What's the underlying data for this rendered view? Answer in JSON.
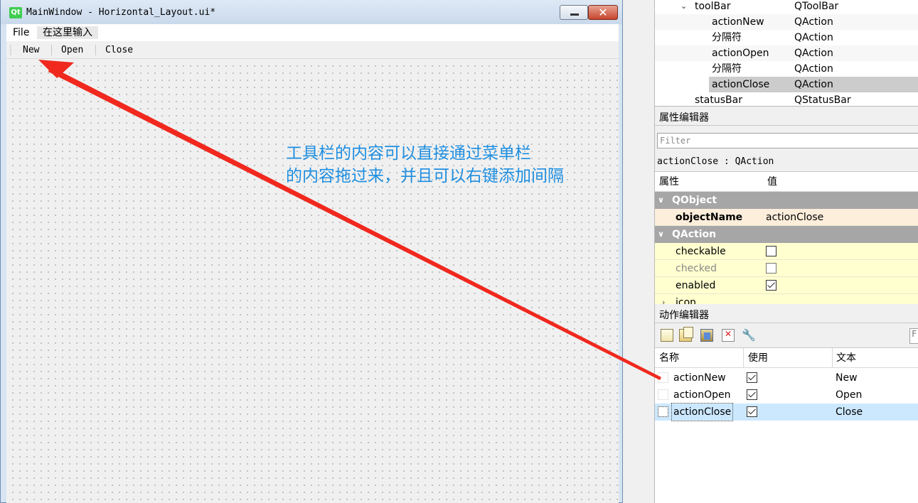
{
  "form_window": {
    "title": "MainWindow - Horizontal_Layout.ui*",
    "icon_label": "Qt",
    "menu": [
      "File",
      "在这里输入"
    ],
    "toolbar": [
      "New",
      "Open",
      "Close"
    ]
  },
  "annotation": {
    "line1": "工具栏的内容可以直接通过菜单栏",
    "line2": "的内容拖过来，并且可以右键添加间隔"
  },
  "object_inspector": {
    "rows": [
      {
        "name": "toolBar",
        "class": "QToolBar"
      },
      {
        "name": "actionNew",
        "class": "QAction"
      },
      {
        "name": "分隔符",
        "class": "QAction"
      },
      {
        "name": "actionOpen",
        "class": "QAction"
      },
      {
        "name": "分隔符",
        "class": "QAction"
      },
      {
        "name": "actionClose",
        "class": "QAction"
      },
      {
        "name": "statusBar",
        "class": "QStatusBar"
      }
    ]
  },
  "property_editor": {
    "title": "属性编辑器",
    "filter_placeholder": "Filter",
    "current_object": "actionClose : QAction",
    "header_property": "属性",
    "header_value": "值",
    "groups": [
      "QObject",
      "QAction"
    ],
    "object_name_label": "objectName",
    "object_name_value": "actionClose",
    "props": [
      {
        "name": "checkable",
        "checked": false
      },
      {
        "name": "checked",
        "checked": false
      },
      {
        "name": "enabled",
        "checked": true
      },
      {
        "name": "icon"
      }
    ]
  },
  "action_editor": {
    "title": "动作编辑器",
    "filter_stub": "F",
    "headers": [
      "名称",
      "使用",
      "文本"
    ],
    "rows": [
      {
        "name": "actionNew",
        "used": true,
        "text": "New"
      },
      {
        "name": "actionOpen",
        "used": true,
        "text": "Open"
      },
      {
        "name": "actionClose",
        "used": true,
        "text": "Close"
      }
    ]
  },
  "colors": {
    "annotation_text": "#1e8ee0",
    "arrow": "#f0281e",
    "group_header": "#a6a6a6",
    "selected_row": "#cce8ff"
  }
}
